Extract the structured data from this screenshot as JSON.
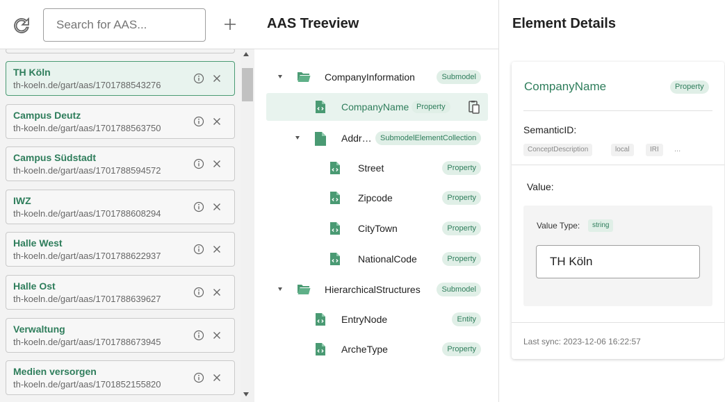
{
  "search": {
    "placeholder": "Search for AAS..."
  },
  "aas_list": [
    {
      "name": "TH Köln",
      "id": "th-koeln.de/gart/aas/1701788543276",
      "selected": true
    },
    {
      "name": "Campus Deutz",
      "id": "th-koeln.de/gart/aas/1701788563750"
    },
    {
      "name": "Campus Südstadt",
      "id": "th-koeln.de/gart/aas/1701788594572"
    },
    {
      "name": "IWZ",
      "id": "th-koeln.de/gart/aas/1701788608294"
    },
    {
      "name": "Halle West",
      "id": "th-koeln.de/gart/aas/1701788622937"
    },
    {
      "name": "Halle Ost",
      "id": "th-koeln.de/gart/aas/1701788639627"
    },
    {
      "name": "Verwaltung",
      "id": "th-koeln.de/gart/aas/1701788673945"
    },
    {
      "name": "Medien versorgen",
      "id": "th-koeln.de/gart/aas/1701852155820"
    }
  ],
  "treeview": {
    "title": "AAS Treeview",
    "nodes": [
      {
        "label": "CompanyInformation",
        "type": "Submodel",
        "icon": "folder-open-icon",
        "expanded": true
      },
      {
        "label": "CompanyName",
        "type": "Property",
        "icon": "property-icon",
        "selected": true
      },
      {
        "label": "Addr…",
        "type": "SubmodelElementCollection",
        "icon": "collection-icon",
        "expanded": true
      },
      {
        "label": "Street",
        "type": "Property",
        "icon": "property-icon"
      },
      {
        "label": "Zipcode",
        "type": "Property",
        "icon": "property-icon"
      },
      {
        "label": "CityTown",
        "type": "Property",
        "icon": "property-icon"
      },
      {
        "label": "NationalCode",
        "type": "Property",
        "icon": "property-icon"
      },
      {
        "label": "HierarchicalStructures",
        "type": "Submodel",
        "icon": "folder-open-icon",
        "expanded": true
      },
      {
        "label": "EntryNode",
        "type": "Entity",
        "icon": "property-icon"
      },
      {
        "label": "ArcheType",
        "type": "Property",
        "icon": "property-icon"
      }
    ]
  },
  "details": {
    "title": "Element Details",
    "element_name": "CompanyName",
    "element_type": "Property",
    "semantic_label": "SemanticID:",
    "semantic_chips": [
      "ConceptDescription",
      "local",
      "IRI"
    ],
    "semantic_more": "...",
    "value_label": "Value:",
    "value_type_label": "Value Type:",
    "value_type": "string",
    "value": "TH Köln",
    "last_sync": "Last sync: 2023-12-06 16:22:57"
  },
  "colors": {
    "accent": "#2e7d5b",
    "chip_bg": "#e0efe7",
    "selected_bg": "#e8f3ee"
  }
}
